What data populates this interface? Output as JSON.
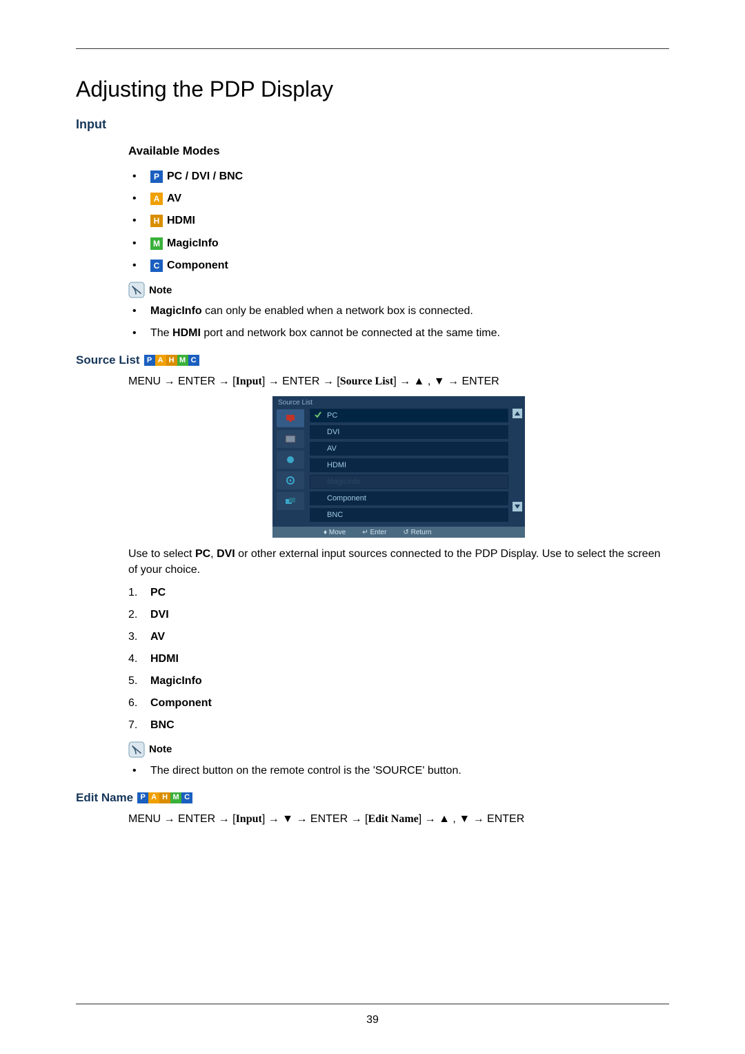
{
  "page_number": "39",
  "main_title": "Adjusting the PDP Display",
  "input": {
    "heading": "Input",
    "available_modes_heading": "Available Modes",
    "modes": [
      {
        "badge": "P",
        "label": "PC / DVI / BNC"
      },
      {
        "badge": "A",
        "label": "AV"
      },
      {
        "badge": "H",
        "label": "HDMI"
      },
      {
        "badge": "M",
        "label": "MagicInfo"
      },
      {
        "badge": "C",
        "label": "Component"
      }
    ],
    "note_label": "Note",
    "note_items_pre": [
      {
        "bold": "MagicInfo",
        "rest": " can only be enabled when a network box is connected."
      }
    ],
    "note_items": [
      {
        "pre": "The ",
        "bold": "HDMI",
        "rest": " port and network box cannot be connected at the same time."
      }
    ]
  },
  "source_list": {
    "heading": "Source List",
    "badges": "PAHMC",
    "nav_parts": {
      "p1": "MENU → ENTER → [",
      "input": "Input",
      "p2": "] → ENTER → [",
      "sl": "Source List",
      "p3": "] → ",
      "up": "▲",
      "comma": " , ",
      "down": "▼",
      "p4": " → ENTER"
    },
    "osd": {
      "title": "Source List",
      "items": [
        {
          "label": "PC",
          "state": "selected",
          "check": true
        },
        {
          "label": "DVI",
          "state": "normal"
        },
        {
          "label": "AV",
          "state": "normal"
        },
        {
          "label": "HDMI",
          "state": "normal"
        },
        {
          "label": "MagicInfo",
          "state": "disabled"
        },
        {
          "label": "Component",
          "state": "normal"
        },
        {
          "label": "BNC",
          "state": "normal"
        }
      ],
      "footer": {
        "move": "Move",
        "enter": "Enter",
        "ret": "Return"
      }
    },
    "body_pre": "Use to select ",
    "body_b1": "PC",
    "body_mid1": ", ",
    "body_b2": "DVI",
    "body_mid2": " or other external input sources connected to the PDP Display. Use to select the screen of your choice.",
    "ol": [
      "PC",
      "DVI",
      "AV",
      "HDMI",
      "MagicInfo",
      "Component",
      "BNC"
    ],
    "note2_label": "Note",
    "note2_text": "The direct button on the remote control is the 'SOURCE' button."
  },
  "edit_name": {
    "heading": "Edit Name",
    "badges": "PAHMC",
    "nav_parts": {
      "p1": "MENU → ENTER → [",
      "input": "Input",
      "p2": "] → ",
      "down": "▼",
      "p3": " → ENTER → [",
      "en": "Edit Name",
      "p4": "] → ",
      "up": "▲",
      "comma": " , ",
      "down2": "▼",
      "p5": " → ENTER"
    }
  }
}
